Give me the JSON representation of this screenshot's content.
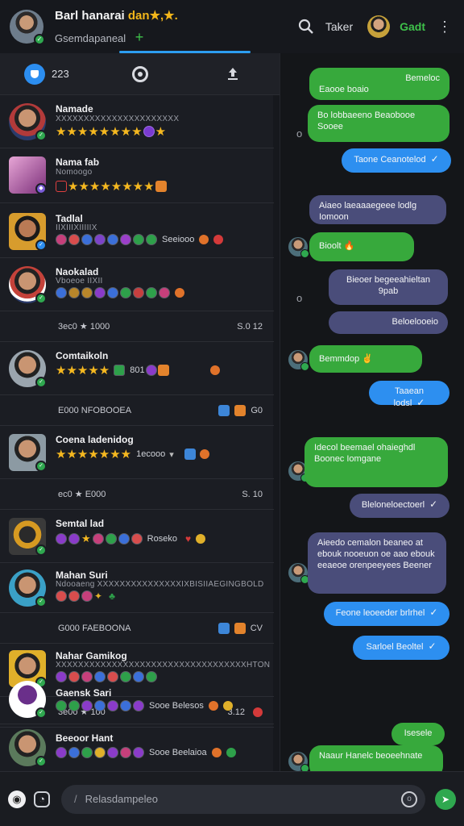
{
  "header": {
    "title": "Barl hanarai",
    "title_accent": "dan",
    "title_stars": "★,★.",
    "subtitle": "Gsemdapaneal",
    "search_label": "Taker",
    "right_label": "Gadt"
  },
  "tabs": [
    {
      "label": "223"
    },
    {
      "label": ""
    },
    {
      "label": ""
    }
  ],
  "list": {
    "items": [
      {
        "name": "Namade",
        "sub": "XXXXXXXXXXXXXXXXXXXXXX",
        "stars": "★★★★★★★★",
        "extra": ""
      },
      {
        "name": "Nama fab",
        "sub": "Nomoogo",
        "stars": "★★★★★★★★",
        "extra": ""
      },
      {
        "name": "Tadlal",
        "sub": "IIXIIIXIIIIIX",
        "badges_text": "Seeiooo",
        "extra": ""
      },
      {
        "name": "Naokalad",
        "sub": "Vboeoe IIXII",
        "badges_text": "",
        "extra": ""
      },
      {
        "name": "Comtaikoln",
        "stars": "★★★★★",
        "badges_text": "801",
        "extra": ""
      },
      {
        "name": "Coena ladenidog",
        "stars": "★★★★★★★",
        "badges_text": "1ecooo",
        "extra": ""
      },
      {
        "name": "Semtal lad",
        "badges_text": "Roseko",
        "extra": ""
      },
      {
        "name": "Mahan Suri",
        "sub": "Ndooaeng XXXXXXXXXXXXXXXIXBISIIAEGINGBOLD",
        "badges_text": "",
        "extra": ""
      },
      {
        "name": "Nahar Gamikog",
        "sub": "XXXXXXXXXXXXXXXXXXXXXXXXXXXXXXXXXXHTON",
        "badges_text": "",
        "extra": ""
      },
      {
        "name": "Gaensk Sari",
        "badges_text": "Sooe Belesos",
        "extra": ""
      },
      {
        "name": "Beeoor Hant",
        "badges_text": "Sooe Beelaioa",
        "extra": ""
      }
    ],
    "separators": [
      {
        "left": "3ec0 ★ 1000",
        "right": "S.0 12"
      },
      {
        "left": "E000 NFOBOOEA",
        "right": "G0"
      },
      {
        "left": "ec0 ★ E000",
        "right": "S. 10"
      },
      {
        "left": "G000 FAEBOONA",
        "right": "CV"
      },
      {
        "left": "3e00 ★ 100",
        "right": "3.12"
      }
    ]
  },
  "chat": {
    "messages": [
      {
        "text": "Bemeloc",
        "style": "green"
      },
      {
        "text": "Eaooe boaio",
        "style": "green"
      },
      {
        "text": "Bo lobbaeeno Beaobooe Sooee",
        "style": "green"
      },
      {
        "text": "Taone Ceanotelod",
        "style": "blue"
      },
      {
        "text": "Aiaeo laeaaaegeee lodlg Iomoon",
        "style": "purple"
      },
      {
        "text": "Bioolt",
        "style": "green"
      },
      {
        "text": "Bieoer begeeahieltan 9pab",
        "style": "purple"
      },
      {
        "text": "Beloelooeio",
        "style": "purple"
      },
      {
        "text": "Bemmdop",
        "style": "green"
      },
      {
        "text": "Taaean lodsl",
        "style": "blue"
      },
      {
        "text": "Idecol beemael ohaieghdl Boonec Iomgane",
        "style": "green"
      },
      {
        "text": "Bleloneloectoerl",
        "style": "purple"
      },
      {
        "text": "Aieedo cemalon beaneo at ebouk nooeuon oe aao ebouk eeaeoe orenpeeyees Beener",
        "style": "purple"
      },
      {
        "text": "Feone leoeeder brlrhel",
        "style": "blue"
      },
      {
        "text": "Sarloel Beoltel",
        "style": "blue"
      },
      {
        "text": "Isesele",
        "style": "green"
      },
      {
        "text": "Naaur Hanelc beoeehnate",
        "style": "green"
      }
    ]
  },
  "composer": {
    "placeholder": "Relasdampeleo"
  },
  "colors": {
    "accent_blue": "#2d8ff0",
    "bubble_green": "#37a93c",
    "bubble_purple": "#4a4d7a",
    "star": "#f5b820",
    "online": "#2fa84f"
  }
}
